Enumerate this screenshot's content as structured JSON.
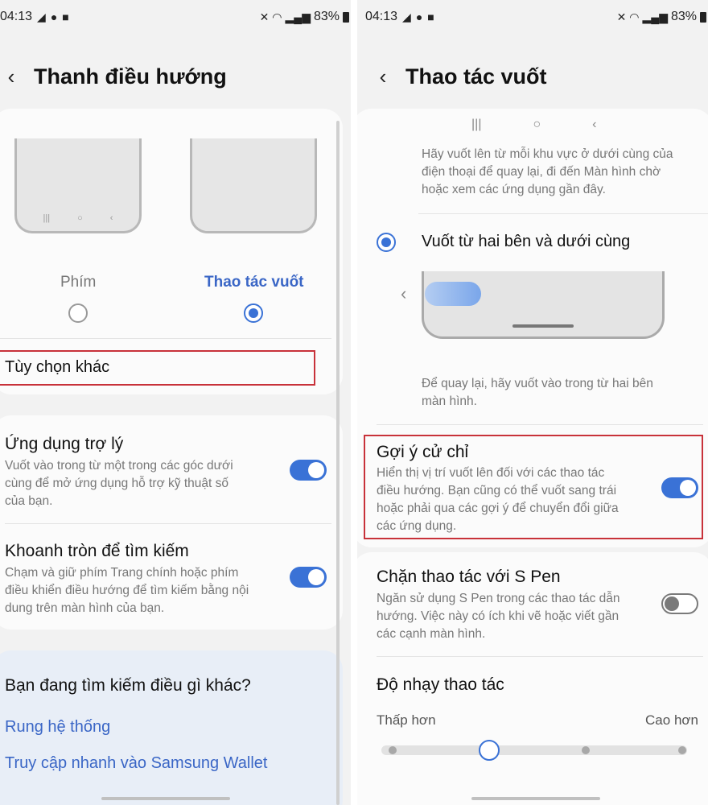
{
  "left": {
    "status": {
      "time": "04:13",
      "battery": "83%"
    },
    "header": {
      "title": "Thanh điều hướng"
    },
    "nav_types": [
      {
        "label": "Phím",
        "selected": false
      },
      {
        "label": "Thao tác vuốt",
        "selected": true
      }
    ],
    "more_options": "Tùy chọn khác",
    "settings": [
      {
        "title": "Ứng dụng trợ lý",
        "desc_lines": [
          "Vuốt vào trong từ một trong các góc dưới",
          "cùng để mở ứng dụng hỗ trợ kỹ thuật số",
          "của bạn."
        ],
        "enabled": true
      },
      {
        "title": "Khoanh tròn để tìm kiếm",
        "desc_lines": [
          "Chạm và giữ phím Trang chính hoặc phím",
          "điều khiển điều hướng để tìm kiếm bằng nội",
          "dung trên màn hình của bạn."
        ],
        "enabled": true
      }
    ],
    "search_box": {
      "heading": "Bạn đang tìm kiếm điều gì khác?",
      "links": [
        "Rung hệ thống",
        "Truy cập nhanh vào Samsung Wallet"
      ]
    }
  },
  "right": {
    "status": {
      "time": "04:13",
      "battery": "83%"
    },
    "header": {
      "title": "Thao tác vuốt"
    },
    "top_desc_lines": [
      "Hãy vuốt lên từ mỗi khu vực ở dưới cùng của",
      "điện thoại để quay lại, đi đến Màn hình chờ",
      "hoặc xem các ứng dụng gần đây."
    ],
    "option": {
      "label": "Vuốt từ hai bên và dưới cùng",
      "selected": true
    },
    "option_desc_lines": [
      "Để quay lại, hãy vuốt vào trong từ hai bên",
      "màn hình."
    ],
    "settings": [
      {
        "title": "Gợi ý cử chỉ",
        "desc_lines": [
          "Hiển thị vị trí vuốt lên đối với các thao tác",
          "điều hướng. Bạn cũng có thể vuốt sang trái",
          "hoặc phải qua các gợi ý để chuyển đổi giữa",
          "các ứng dụng."
        ],
        "enabled": true
      },
      {
        "title": "Chặn thao tác với S Pen",
        "desc_lines": [
          "Ngăn sử dụng S Pen trong các thao tác dẫn",
          "hướng. Việc này có ích khi vẽ hoặc viết gần",
          "các cạnh màn hình."
        ],
        "enabled": false
      }
    ],
    "sensitivity": {
      "title": "Độ nhạy thao tác",
      "low_label": "Thấp hơn",
      "high_label": "Cao hơn",
      "level": 1,
      "steps": 4
    }
  }
}
